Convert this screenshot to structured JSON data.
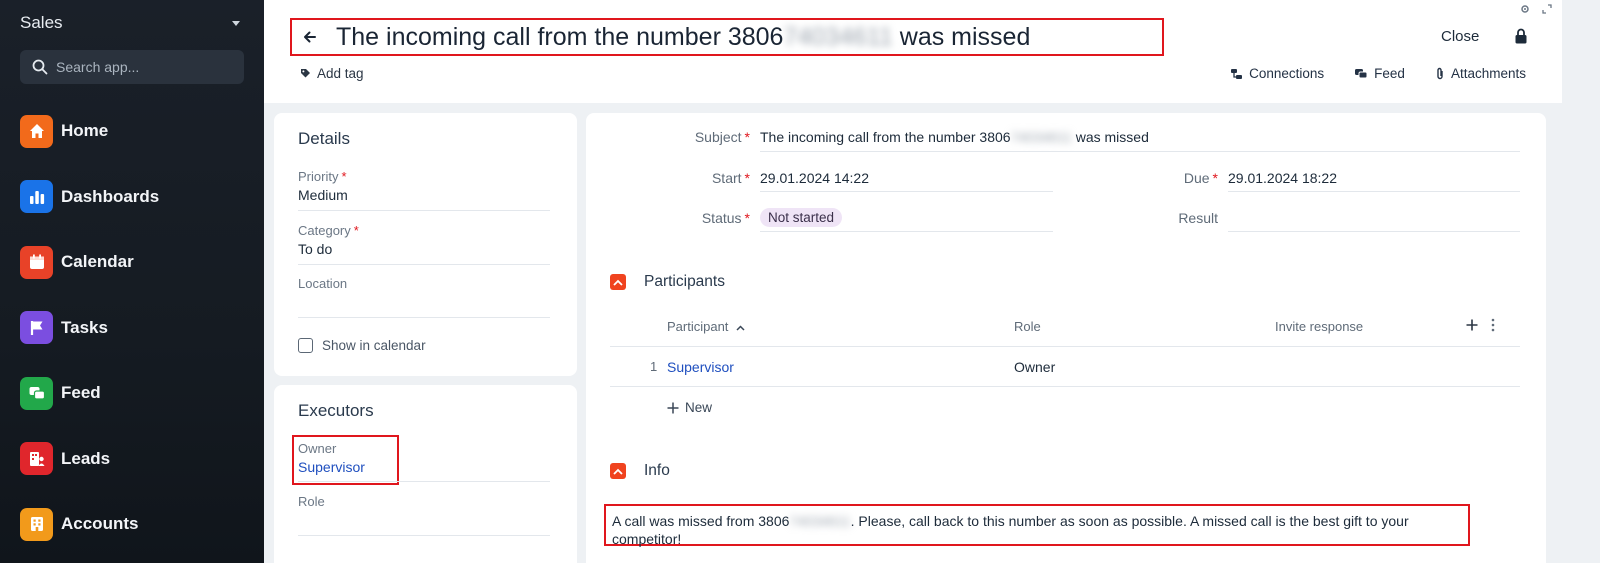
{
  "sidebar": {
    "title": "Sales",
    "search_placeholder": "Search app...",
    "items": [
      {
        "label": "Home",
        "icon": "home-icon",
        "color": "#f26a1b"
      },
      {
        "label": "Dashboards",
        "icon": "bar-chart-icon",
        "color": "#1a73e8"
      },
      {
        "label": "Calendar",
        "icon": "calendar-icon",
        "color": "#e84228"
      },
      {
        "label": "Tasks",
        "icon": "flag-icon",
        "color": "#7b4ee0"
      },
      {
        "label": "Feed",
        "icon": "chat-icon",
        "color": "#22a84a"
      },
      {
        "label": "Leads",
        "icon": "leads-icon",
        "color": "#e0262c"
      },
      {
        "label": "Accounts",
        "icon": "building-icon",
        "color": "#f29a1b"
      }
    ]
  },
  "header": {
    "title_prefix": "The incoming call from the number 3806",
    "title_blurred": "74034611",
    "title_suffix": " was missed",
    "close_label": "Close",
    "add_tag_label": "Add tag",
    "links": [
      "Connections",
      "Feed",
      "Attachments"
    ]
  },
  "details": {
    "title": "Details",
    "priority_label": "Priority",
    "priority_value": "Medium",
    "category_label": "Category",
    "category_value": "To do",
    "location_label": "Location",
    "location_value": "",
    "show_calendar_label": "Show in calendar"
  },
  "executors": {
    "title": "Executors",
    "owner_label": "Owner",
    "owner_value": "Supervisor",
    "role_label": "Role"
  },
  "main": {
    "subject_label": "Subject",
    "subject_prefix": "The incoming call from the number 3806",
    "subject_blurred": "74034611",
    "subject_suffix": " was missed",
    "start_label": "Start",
    "start_value": "29.01.2024 14:22",
    "due_label": "Due",
    "due_value": "29.01.2024 18:22",
    "status_label": "Status",
    "status_value": "Not started",
    "result_label": "Result",
    "participants": {
      "title": "Participants",
      "columns": [
        "Participant",
        "Role",
        "Invite response"
      ],
      "rows": [
        {
          "index": "1",
          "participant": "Supervisor",
          "role": "Owner"
        }
      ],
      "new_label": "New"
    },
    "info": {
      "title": "Info",
      "text_prefix": "A call was missed from 3806",
      "text_blurred": "74034611",
      "text_suffix": ". Please, call back to this number as soon as possible. A missed call is the best gift to your competitor!"
    }
  }
}
